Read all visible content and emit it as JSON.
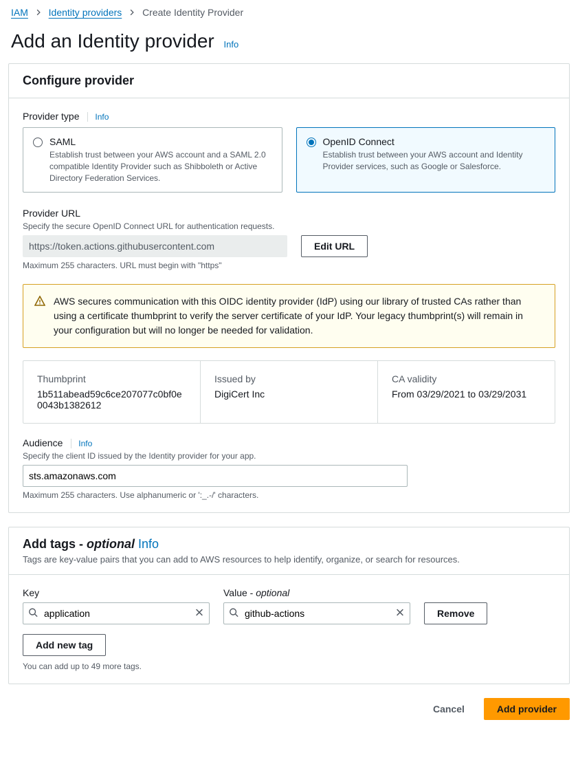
{
  "breadcrumb": {
    "root": "IAM",
    "middle": "Identity providers",
    "current": "Create Identity Provider"
  },
  "page": {
    "title": "Add an Identity provider",
    "info": "Info"
  },
  "configure": {
    "heading": "Configure provider",
    "provider_type_label": "Provider type",
    "info": "Info",
    "saml": {
      "title": "SAML",
      "desc": "Establish trust between your AWS account and a SAML 2.0 compatible Identity Provider such as Shibboleth or Active Directory Federation Services."
    },
    "oidc": {
      "title": "OpenID Connect",
      "desc": "Establish trust between your AWS account and Identity Provider services, such as Google or Salesforce."
    },
    "provider_url_label": "Provider URL",
    "provider_url_help": "Specify the secure OpenID Connect URL for authentication requests.",
    "provider_url_value": "https://token.actions.githubusercontent.com",
    "edit_url_btn": "Edit URL",
    "provider_url_constraint": "Maximum 255 characters. URL must begin with \"https\"",
    "alert_text": "AWS secures communication with this OIDC identity provider (IdP) using our library of trusted CAs rather than using a certificate thumbprint to verify the server certificate of your IdP. Your legacy thumbprint(s) will remain in your configuration but will no longer be needed for validation.",
    "thumbprint_label": "Thumbprint",
    "thumbprint_value": "1b511abead59c6ce207077c0bf0e0043b1382612",
    "issued_label": "Issued by",
    "issued_value": "DigiCert Inc",
    "validity_label": "CA validity",
    "validity_value": "From 03/29/2021 to 03/29/2031",
    "audience_label": "Audience",
    "audience_info": "Info",
    "audience_help": "Specify the client ID issued by the Identity provider for your app.",
    "audience_value": "sts.amazonaws.com",
    "audience_constraint": "Maximum 255 characters. Use alphanumeric or ':_.-/' characters."
  },
  "tags": {
    "heading_prefix": "Add tags - ",
    "heading_suffix": "optional",
    "info": "Info",
    "desc": "Tags are key-value pairs that you can add to AWS resources to help identify, organize, or search for resources.",
    "key_label": "Key",
    "value_label_prefix": "Value - ",
    "value_label_suffix": "optional",
    "key_value": "application",
    "val_value": "github-actions",
    "remove_btn": "Remove",
    "add_btn": "Add new tag",
    "limit_text": "You can add up to 49 more tags."
  },
  "footer": {
    "cancel": "Cancel",
    "submit": "Add provider"
  }
}
